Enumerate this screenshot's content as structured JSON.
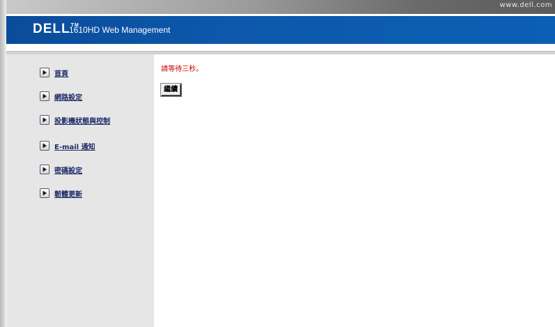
{
  "topbar": {
    "url_text": "www.dell.com"
  },
  "header": {
    "logo_text": "DELL",
    "logo_tm": "TM",
    "title": "1610HD Web Management",
    "background_color": "#0b57aa"
  },
  "sidebar": {
    "items": [
      {
        "label": "首頁",
        "icon": "play-arrow-icon"
      },
      {
        "label": "網路設定",
        "icon": "play-arrow-icon"
      },
      {
        "label": "投影機狀態與控制",
        "icon": "play-arrow-icon"
      },
      {
        "label": "E-mail 通知",
        "icon": "play-arrow-icon"
      },
      {
        "label": "密碼設定",
        "icon": "play-arrow-icon"
      },
      {
        "label": "韌體更新",
        "icon": "play-arrow-icon"
      }
    ]
  },
  "main": {
    "message": "請等待三秒。",
    "message_color": "#cc0000",
    "continue_label": "繼續"
  }
}
